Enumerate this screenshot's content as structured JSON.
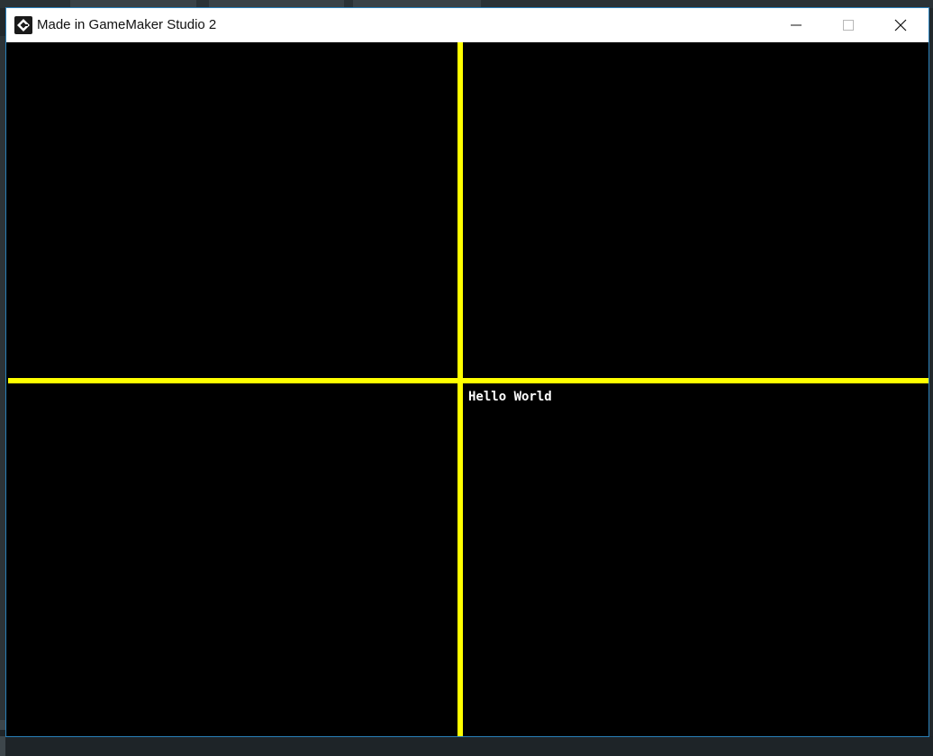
{
  "window": {
    "title": "Made in GameMaker Studio 2",
    "app_icon": "gamemaker-icon",
    "controls": {
      "minimize_icon": "minimize-icon",
      "maximize_icon": "maximize-icon",
      "close_icon": "close-icon"
    }
  },
  "game": {
    "background_color": "#000000",
    "crosshair_color": "#ffff00",
    "text": "Hello World",
    "text_color": "#ffffff"
  },
  "background_app": {
    "accent_color": "#1b9e77"
  }
}
